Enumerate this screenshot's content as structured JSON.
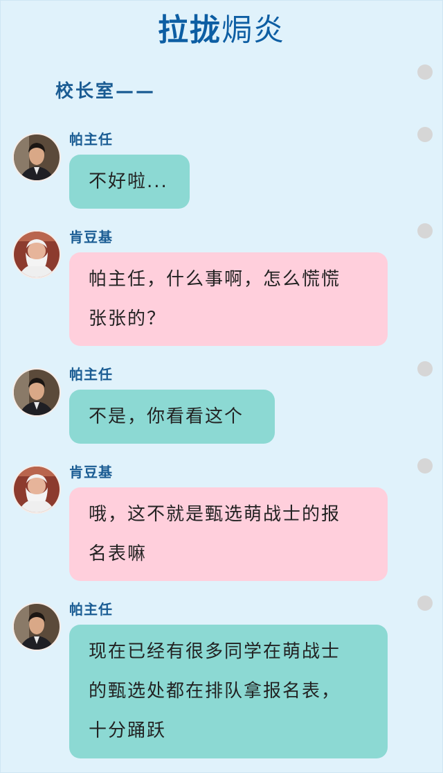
{
  "title": {
    "part1": "拉拢",
    "part2": "焗炎"
  },
  "scene": "校长室——",
  "colors": {
    "background": "#e0f2fb",
    "title": "#0d5ea3",
    "speaker": "#1a5c93",
    "bubble_pa": "#8cd9d3",
    "bubble_ken": "#ffcfdc",
    "rail_dot": "#d6d6d6"
  },
  "messages": [
    {
      "speaker": "帕主任",
      "avatar": "man-portrait-avatar",
      "lines": [
        "不好啦..."
      ]
    },
    {
      "speaker": "肯豆基",
      "avatar": "white-bearded-man-avatar",
      "lines": [
        "帕主任，什么事啊，怎么慌慌",
        "张张的？"
      ]
    },
    {
      "speaker": "帕主任",
      "avatar": "man-portrait-avatar",
      "lines": [
        "不是，你看看这个"
      ]
    },
    {
      "speaker": "肯豆基",
      "avatar": "white-bearded-man-avatar",
      "lines": [
        "哦，这不就是甄选萌战士的报",
        "名表嘛"
      ]
    },
    {
      "speaker": "帕主任",
      "avatar": "man-portrait-avatar",
      "lines": [
        "现在已经有很多同学在萌战士",
        "的甄选处都在排队拿报名表，",
        "十分踊跃"
      ]
    }
  ]
}
